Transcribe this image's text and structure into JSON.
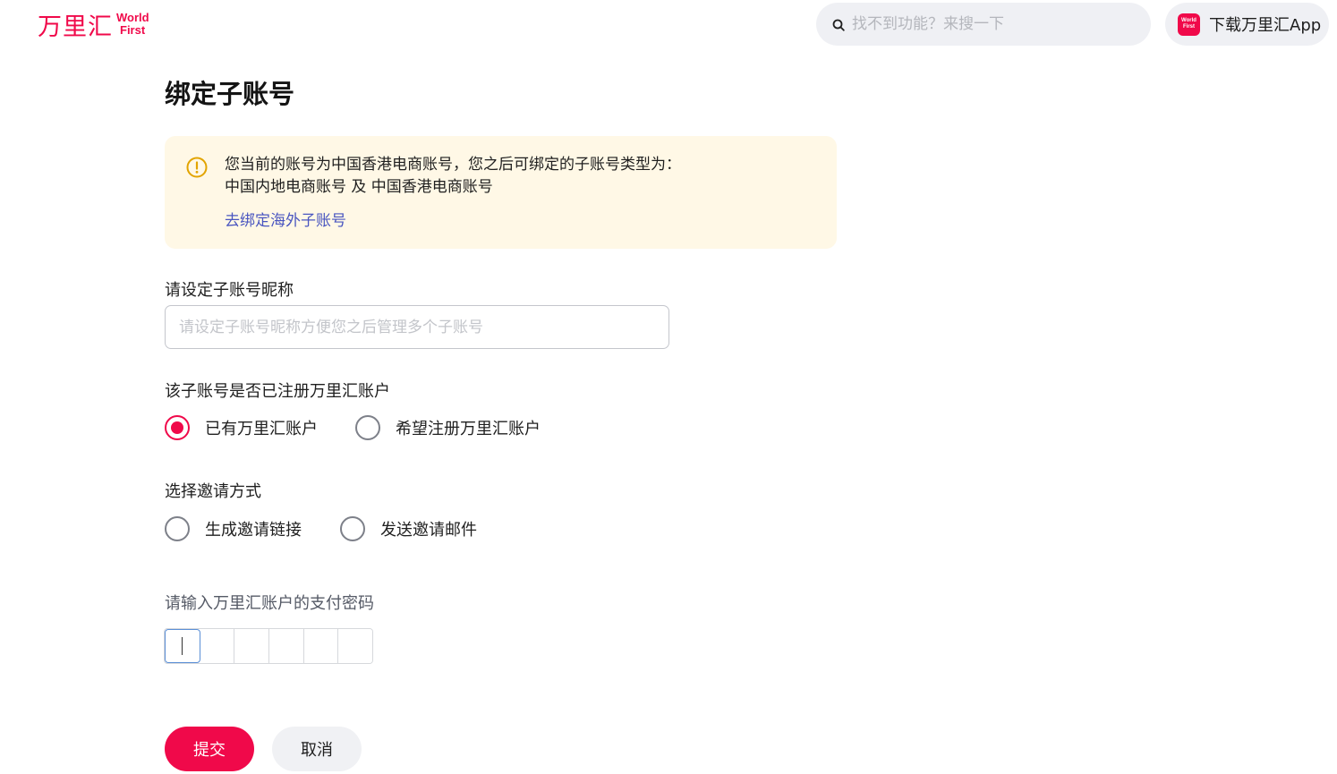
{
  "header": {
    "logo_cn": "万里汇",
    "logo_en_line1": "World",
    "logo_en_line2": "First",
    "search_placeholder": "找不到功能？来搜一下",
    "app_button_label": "下载万里汇App",
    "app_icon_line1": "World",
    "app_icon_line2": "First",
    "brand_color": "#f0094a"
  },
  "main": {
    "title": "绑定子账号",
    "notice": {
      "line1": "您当前的账号为中国香港电商账号，您之后可绑定的子账号类型为：",
      "line2": "中国内地电商账号 及 中国香港电商账号",
      "link": "去绑定海外子账号",
      "icon": "warning-icon",
      "background": "#fff8e6"
    },
    "nickname": {
      "label": "请设定子账号昵称",
      "placeholder": "请设定子账号昵称方便您之后管理多个子账号",
      "value": ""
    },
    "registered": {
      "label": "该子账号是否已注册万里汇账户",
      "options": [
        {
          "label": "已有万里汇账户",
          "checked": true
        },
        {
          "label": "希望注册万里汇账户",
          "checked": false
        }
      ]
    },
    "invite": {
      "label": "选择邀请方式",
      "options": [
        {
          "label": "生成邀请链接",
          "checked": false
        },
        {
          "label": "发送邀请邮件",
          "checked": false
        }
      ]
    },
    "password": {
      "label": "请输入万里汇账户的支付密码",
      "digits": 6
    },
    "actions": {
      "submit": "提交",
      "cancel": "取消"
    }
  }
}
